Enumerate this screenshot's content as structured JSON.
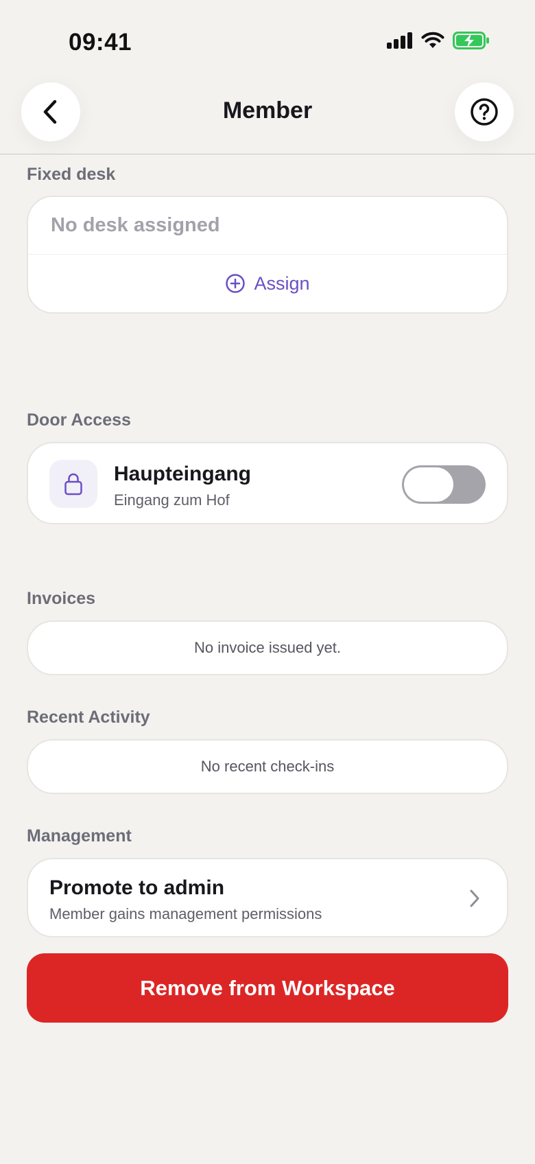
{
  "status_bar": {
    "time": "09:41"
  },
  "nav": {
    "title": "Member"
  },
  "fixed_desk": {
    "label": "Fixed desk",
    "value": "No desk assigned",
    "assign_label": "Assign"
  },
  "door_access": {
    "label": "Door Access",
    "door_name": "Haupteingang",
    "door_subtitle": "Eingang zum Hof",
    "enabled": false
  },
  "invoices": {
    "label": "Invoices",
    "empty_text": "No invoice issued yet."
  },
  "recent_activity": {
    "label": "Recent Activity",
    "empty_text": "No recent check-ins"
  },
  "management": {
    "label": "Management",
    "promote_title": "Promote to admin",
    "promote_subtitle": "Member gains management permissions"
  },
  "remove_button_label": "Remove from Workspace",
  "colors": {
    "background": "#f3f2ef",
    "accent": "#6a4fc4",
    "danger": "#dc2626",
    "battery": "#34c759"
  },
  "icons": {
    "back": "chevron-left-icon",
    "help": "question-circle-icon",
    "assign": "plus-circle-icon",
    "lock": "lock-icon",
    "row_chevron": "chevron-right-icon"
  }
}
